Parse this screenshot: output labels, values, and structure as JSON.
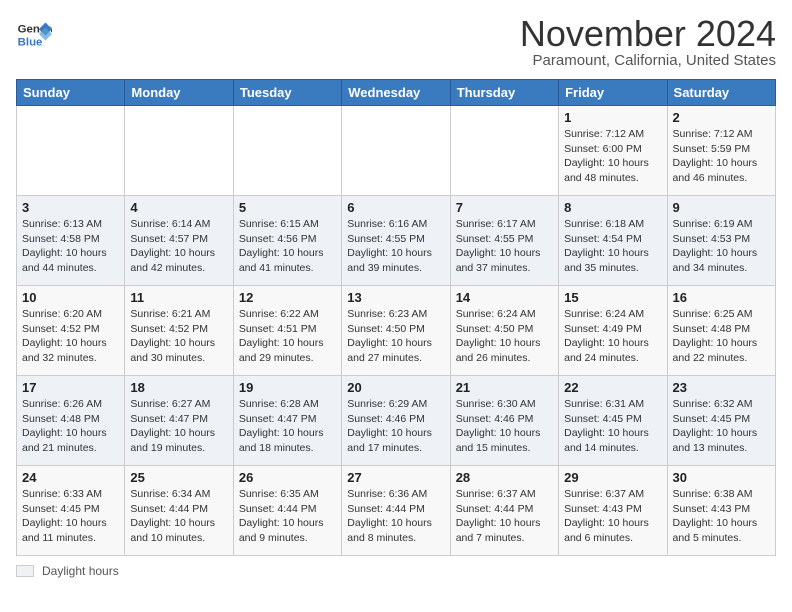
{
  "header": {
    "logo_line1": "General",
    "logo_line2": "Blue",
    "month": "November 2024",
    "location": "Paramount, California, United States"
  },
  "legend": {
    "label": "Daylight hours"
  },
  "days_of_week": [
    "Sunday",
    "Monday",
    "Tuesday",
    "Wednesday",
    "Thursday",
    "Friday",
    "Saturday"
  ],
  "weeks": [
    [
      {
        "day": "",
        "info": ""
      },
      {
        "day": "",
        "info": ""
      },
      {
        "day": "",
        "info": ""
      },
      {
        "day": "",
        "info": ""
      },
      {
        "day": "",
        "info": ""
      },
      {
        "day": "1",
        "info": "Sunrise: 7:12 AM\nSunset: 6:00 PM\nDaylight: 10 hours and 48 minutes."
      },
      {
        "day": "2",
        "info": "Sunrise: 7:12 AM\nSunset: 5:59 PM\nDaylight: 10 hours and 46 minutes."
      }
    ],
    [
      {
        "day": "3",
        "info": "Sunrise: 6:13 AM\nSunset: 4:58 PM\nDaylight: 10 hours and 44 minutes."
      },
      {
        "day": "4",
        "info": "Sunrise: 6:14 AM\nSunset: 4:57 PM\nDaylight: 10 hours and 42 minutes."
      },
      {
        "day": "5",
        "info": "Sunrise: 6:15 AM\nSunset: 4:56 PM\nDaylight: 10 hours and 41 minutes."
      },
      {
        "day": "6",
        "info": "Sunrise: 6:16 AM\nSunset: 4:55 PM\nDaylight: 10 hours and 39 minutes."
      },
      {
        "day": "7",
        "info": "Sunrise: 6:17 AM\nSunset: 4:55 PM\nDaylight: 10 hours and 37 minutes."
      },
      {
        "day": "8",
        "info": "Sunrise: 6:18 AM\nSunset: 4:54 PM\nDaylight: 10 hours and 35 minutes."
      },
      {
        "day": "9",
        "info": "Sunrise: 6:19 AM\nSunset: 4:53 PM\nDaylight: 10 hours and 34 minutes."
      }
    ],
    [
      {
        "day": "10",
        "info": "Sunrise: 6:20 AM\nSunset: 4:52 PM\nDaylight: 10 hours and 32 minutes."
      },
      {
        "day": "11",
        "info": "Sunrise: 6:21 AM\nSunset: 4:52 PM\nDaylight: 10 hours and 30 minutes."
      },
      {
        "day": "12",
        "info": "Sunrise: 6:22 AM\nSunset: 4:51 PM\nDaylight: 10 hours and 29 minutes."
      },
      {
        "day": "13",
        "info": "Sunrise: 6:23 AM\nSunset: 4:50 PM\nDaylight: 10 hours and 27 minutes."
      },
      {
        "day": "14",
        "info": "Sunrise: 6:24 AM\nSunset: 4:50 PM\nDaylight: 10 hours and 26 minutes."
      },
      {
        "day": "15",
        "info": "Sunrise: 6:24 AM\nSunset: 4:49 PM\nDaylight: 10 hours and 24 minutes."
      },
      {
        "day": "16",
        "info": "Sunrise: 6:25 AM\nSunset: 4:48 PM\nDaylight: 10 hours and 22 minutes."
      }
    ],
    [
      {
        "day": "17",
        "info": "Sunrise: 6:26 AM\nSunset: 4:48 PM\nDaylight: 10 hours and 21 minutes."
      },
      {
        "day": "18",
        "info": "Sunrise: 6:27 AM\nSunset: 4:47 PM\nDaylight: 10 hours and 19 minutes."
      },
      {
        "day": "19",
        "info": "Sunrise: 6:28 AM\nSunset: 4:47 PM\nDaylight: 10 hours and 18 minutes."
      },
      {
        "day": "20",
        "info": "Sunrise: 6:29 AM\nSunset: 4:46 PM\nDaylight: 10 hours and 17 minutes."
      },
      {
        "day": "21",
        "info": "Sunrise: 6:30 AM\nSunset: 4:46 PM\nDaylight: 10 hours and 15 minutes."
      },
      {
        "day": "22",
        "info": "Sunrise: 6:31 AM\nSunset: 4:45 PM\nDaylight: 10 hours and 14 minutes."
      },
      {
        "day": "23",
        "info": "Sunrise: 6:32 AM\nSunset: 4:45 PM\nDaylight: 10 hours and 13 minutes."
      }
    ],
    [
      {
        "day": "24",
        "info": "Sunrise: 6:33 AM\nSunset: 4:45 PM\nDaylight: 10 hours and 11 minutes."
      },
      {
        "day": "25",
        "info": "Sunrise: 6:34 AM\nSunset: 4:44 PM\nDaylight: 10 hours and 10 minutes."
      },
      {
        "day": "26",
        "info": "Sunrise: 6:35 AM\nSunset: 4:44 PM\nDaylight: 10 hours and 9 minutes."
      },
      {
        "day": "27",
        "info": "Sunrise: 6:36 AM\nSunset: 4:44 PM\nDaylight: 10 hours and 8 minutes."
      },
      {
        "day": "28",
        "info": "Sunrise: 6:37 AM\nSunset: 4:44 PM\nDaylight: 10 hours and 7 minutes."
      },
      {
        "day": "29",
        "info": "Sunrise: 6:37 AM\nSunset: 4:43 PM\nDaylight: 10 hours and 6 minutes."
      },
      {
        "day": "30",
        "info": "Sunrise: 6:38 AM\nSunset: 4:43 PM\nDaylight: 10 hours and 5 minutes."
      }
    ]
  ]
}
